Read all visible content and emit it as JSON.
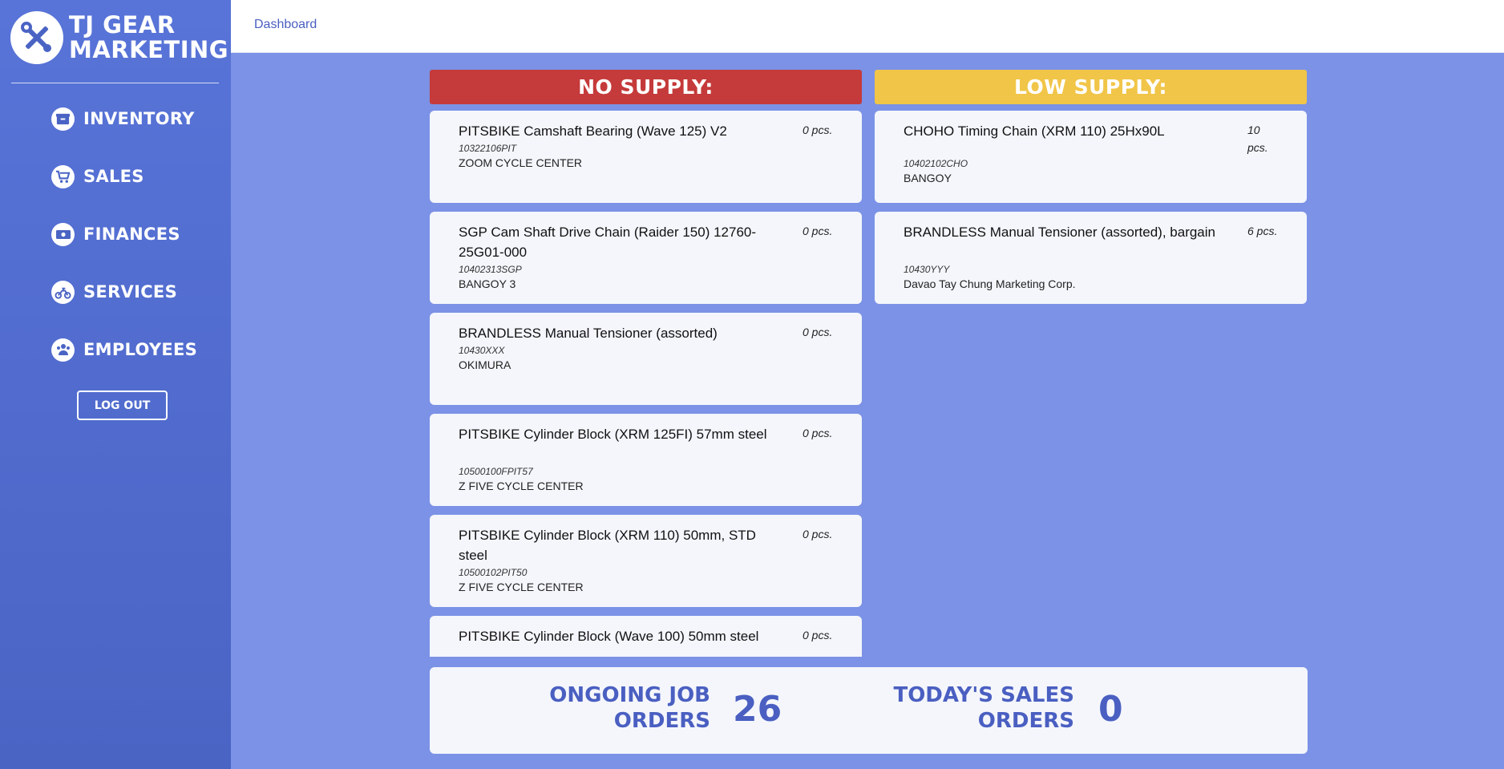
{
  "brand": {
    "line1": "TJ GEAR",
    "line2": "MARKETING",
    "logo_icon": "wrench-screwdriver-icon"
  },
  "colors": {
    "sidebar": "#5874d8",
    "background": "#7b92e6",
    "no_supply": "#c53a3a",
    "low_supply": "#f1c548",
    "accent": "#4a5fc1"
  },
  "nav": [
    {
      "label": "INVENTORY",
      "icon": "inventory-box-icon"
    },
    {
      "label": "SALES",
      "icon": "cart-icon"
    },
    {
      "label": "FINANCES",
      "icon": "cash-icon"
    },
    {
      "label": "SERVICES",
      "icon": "motorcycle-icon"
    },
    {
      "label": "EMPLOYEES",
      "icon": "people-icon"
    }
  ],
  "logout_label": "LOG OUT",
  "breadcrumb": "Dashboard",
  "no_supply": {
    "title": "NO SUPPLY:",
    "items": [
      {
        "name": "PITSBIKE Camshaft Bearing (Wave 125) V2",
        "qty": "0 pcs.",
        "code": "10322106PIT",
        "supplier": "ZOOM CYCLE CENTER"
      },
      {
        "name": "SGP Cam Shaft Drive Chain (Raider 150) 12760-25G01-000",
        "qty": "0 pcs.",
        "code": "10402313SGP",
        "supplier": "BANGOY 3"
      },
      {
        "name": "BRANDLESS Manual Tensioner (assorted)",
        "qty": "0 pcs.",
        "code": "10430XXX",
        "supplier": "OKIMURA"
      },
      {
        "name": "PITSBIKE Cylinder Block (XRM 125FI) 57mm steel",
        "qty": "0 pcs.",
        "code": "10500100FPIT57",
        "supplier": "Z FIVE CYCLE CENTER"
      },
      {
        "name": "PITSBIKE Cylinder Block (XRM 110) 50mm, STD steel",
        "qty": "0 pcs.",
        "code": "10500102PIT50",
        "supplier": "Z FIVE CYCLE CENTER"
      },
      {
        "name": "PITSBIKE Cylinder Block (Wave 100) 50mm steel",
        "qty": "0 pcs.",
        "code": "",
        "supplier": ""
      }
    ]
  },
  "low_supply": {
    "title": "LOW SUPPLY:",
    "items": [
      {
        "name": "CHOHO Timing Chain (XRM 110) 25Hx90L",
        "qty": "10 pcs.",
        "code": "10402102CHO",
        "supplier": "BANGOY"
      },
      {
        "name": "BRANDLESS Manual Tensioner (assorted), bargain",
        "qty": "6 pcs.",
        "code": "10430YYY",
        "supplier": "Davao Tay Chung Marketing Corp."
      }
    ]
  },
  "stats": {
    "job_orders": {
      "label_line1": "ONGOING JOB",
      "label_line2": "ORDERS",
      "value": "26"
    },
    "sales_orders": {
      "label_line1": "TODAY'S SALES",
      "label_line2": "ORDERS",
      "value": "0"
    }
  }
}
